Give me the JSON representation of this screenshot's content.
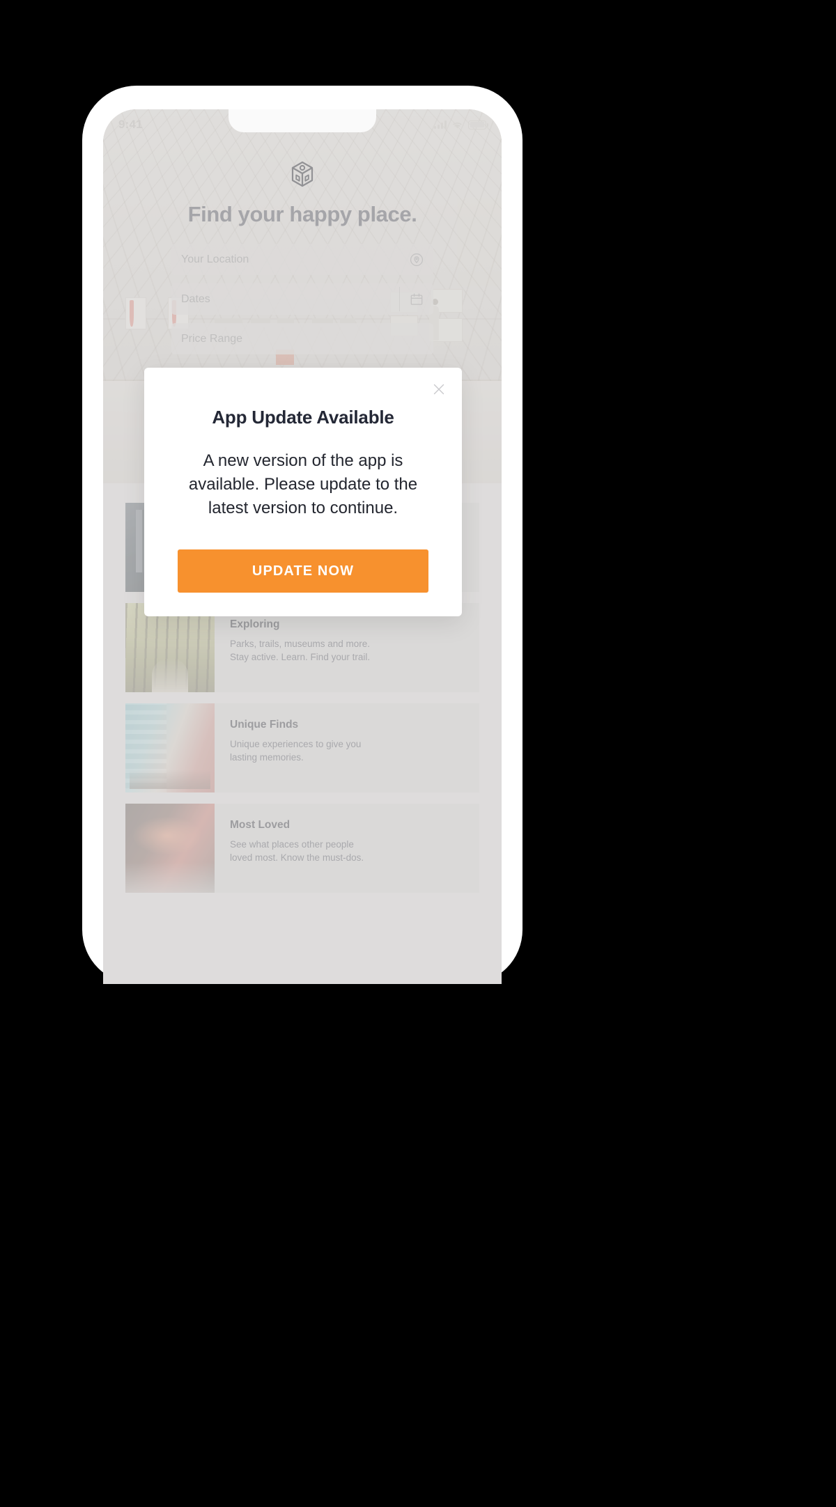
{
  "colors": {
    "accent": "#F7912E",
    "modal_title": "#242836",
    "modal_text": "#23262f",
    "hero_title": "#6d6d74",
    "card_title": "#5f5f64",
    "card_desc": "#74747a",
    "placeholder": "#9b9a99",
    "page_background": "#000000",
    "phone_body": "#ffffff"
  },
  "status_bar": {
    "time": "9:41",
    "icons": [
      "cellular-signal-icon",
      "wifi-icon",
      "battery-icon"
    ]
  },
  "hero": {
    "logo_icon": "cube-logo-icon",
    "title": "Find your happy place.",
    "fields": [
      {
        "name": "location",
        "placeholder": "Your Location",
        "value": "",
        "icon": "location-pin-icon"
      },
      {
        "name": "dates",
        "placeholder": "Dates",
        "value": "",
        "icon": "calendar-icon"
      },
      {
        "name": "price",
        "placeholder": "Price Range",
        "value": "",
        "icon": ""
      }
    ]
  },
  "cards": [
    {
      "title": "",
      "description": "",
      "thumb": "gallery-thumbnail"
    },
    {
      "title": "Exploring",
      "description": "Parks, trails, museums and more.\nStay active. Learn. Find your trail.",
      "thumb": "forest-trail-thumbnail"
    },
    {
      "title": "Unique Finds",
      "description": "Unique experiences to give you\nlasting memories.",
      "thumb": "colorful-street-thumbnail"
    },
    {
      "title": "Most Loved",
      "description": "See what places other people\nloved most. Know the must-dos.",
      "thumb": "cafe-storefront-thumbnail"
    }
  ],
  "modal": {
    "close_icon": "close-icon",
    "title": "App Update Available",
    "body": "A new version of the app is available. Please update to the latest version to continue.",
    "cta_label": "UPDATE NOW"
  }
}
